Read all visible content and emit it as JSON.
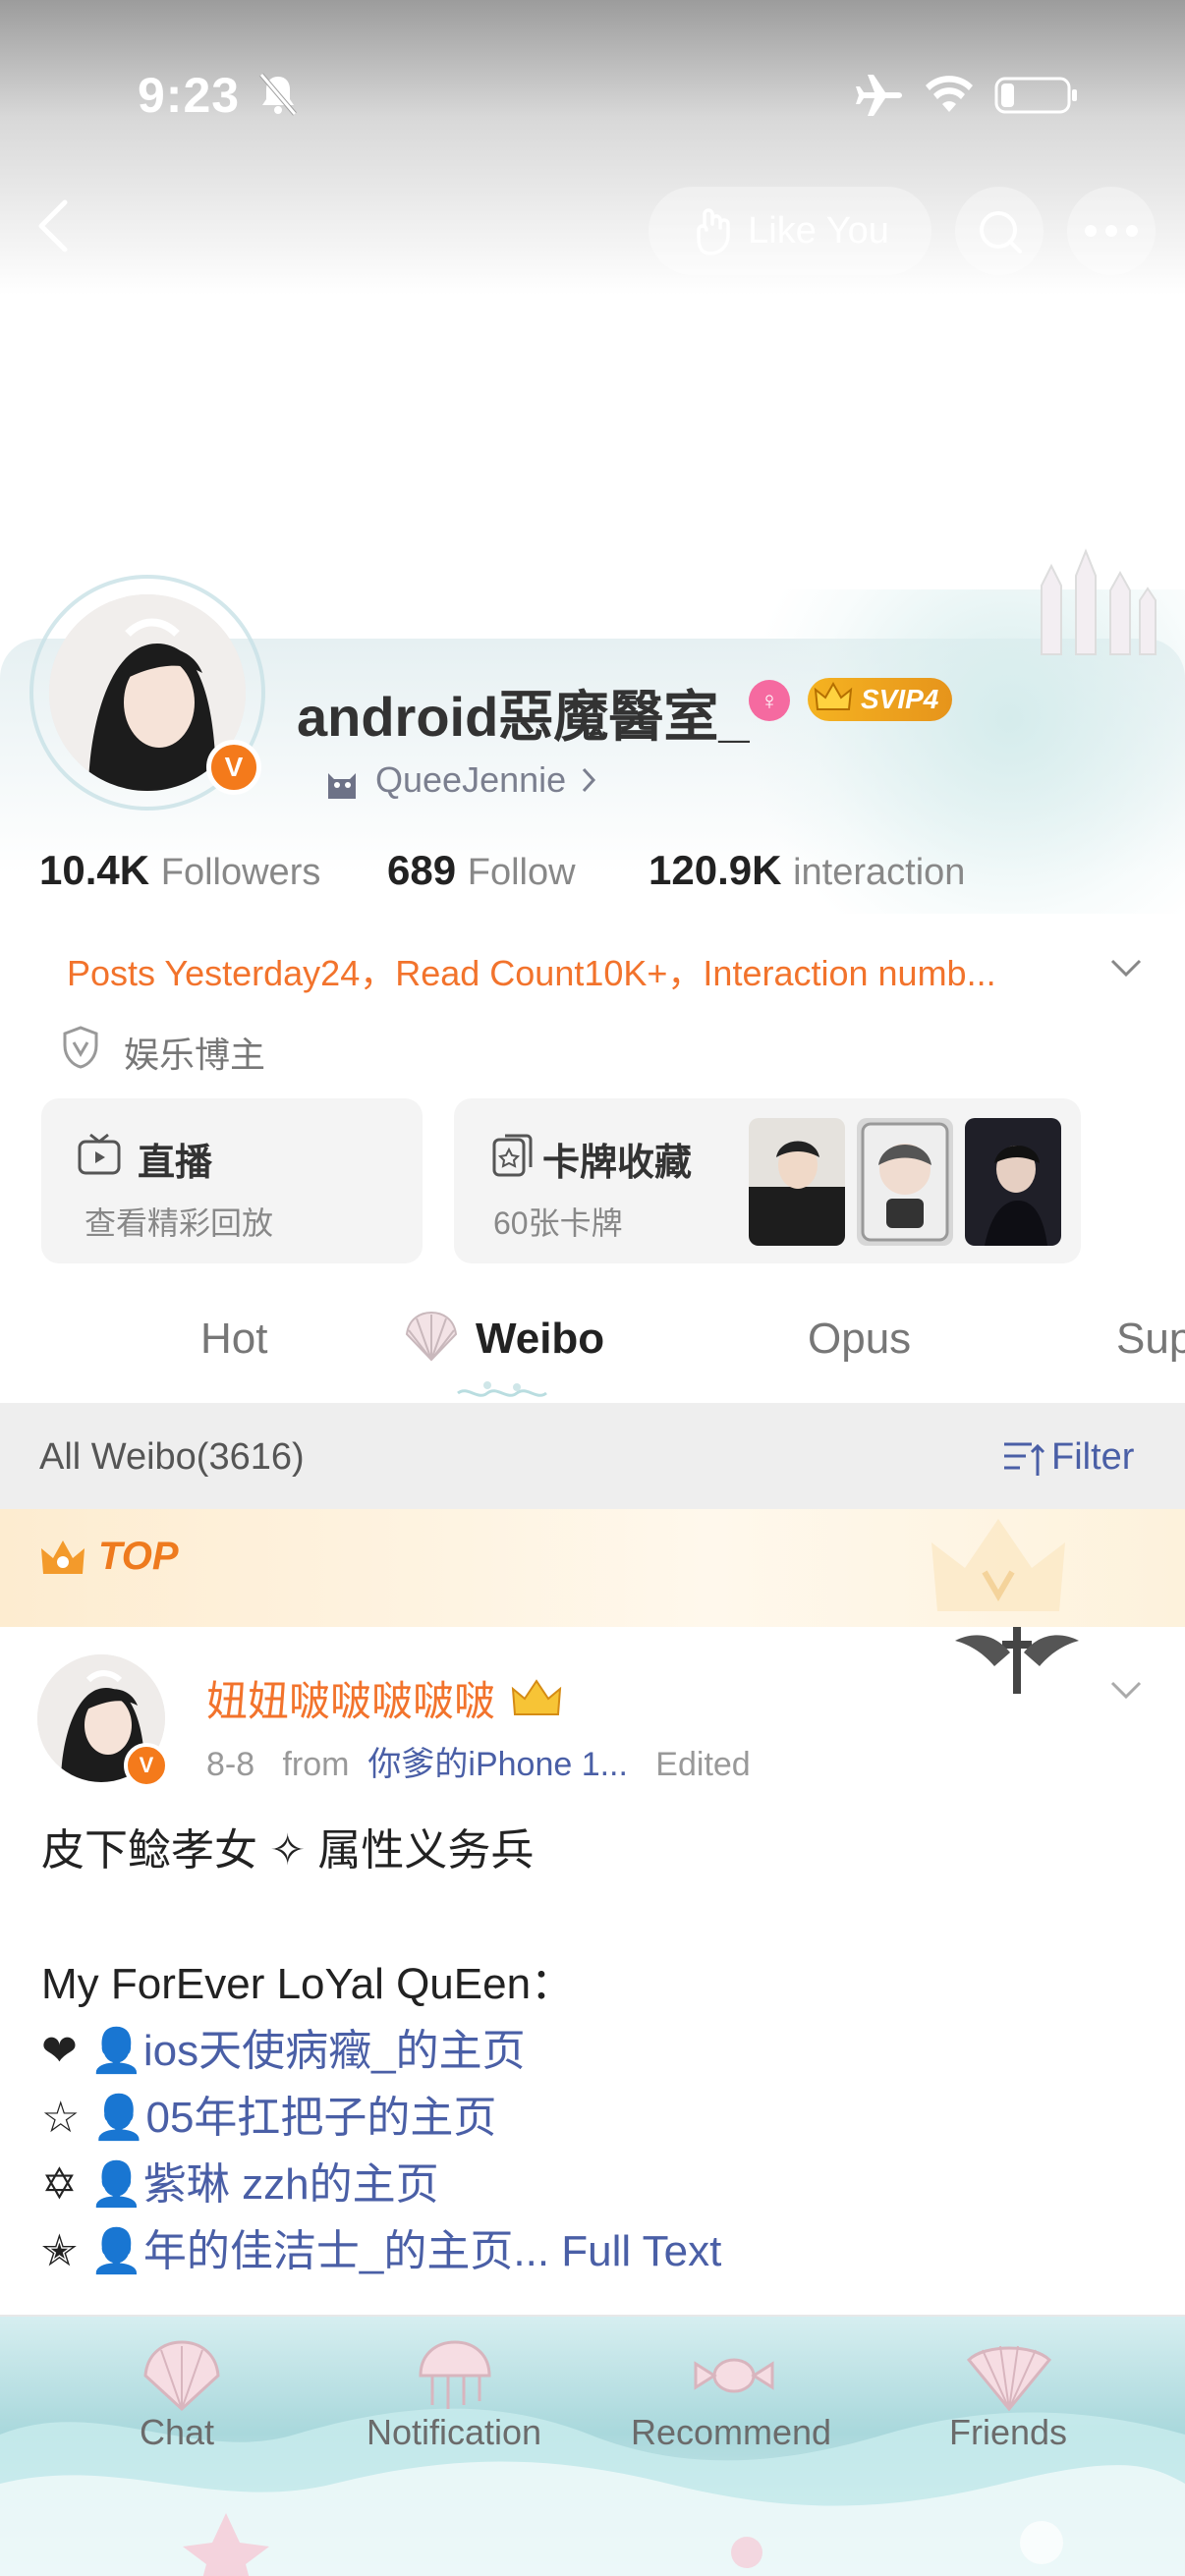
{
  "status_bar": {
    "time": "9:23"
  },
  "header": {
    "like_label": "Like You"
  },
  "profile": {
    "username": "android惡魔醫室_",
    "svip": "SVIP4",
    "sub_link": "QueeJennie",
    "stats": {
      "followers_value": "10.4K",
      "followers_label": "Followers",
      "follow_value": "689",
      "follow_label": "Follow",
      "interaction_value": "120.9K",
      "interaction_label": "interaction"
    },
    "summary": "Posts Yesterday24，Read Count10K+，Interaction numb...",
    "category": "娱乐博主",
    "live_card": {
      "title": "直播",
      "subtitle": "查看精彩回放"
    },
    "cards_card": {
      "title": "卡牌收藏",
      "subtitle": "60张卡牌"
    }
  },
  "tabs": [
    {
      "label": "Hot"
    },
    {
      "label": "Weibo"
    },
    {
      "label": "Opus"
    },
    {
      "label": "Sup"
    }
  ],
  "filter_bar": {
    "all_weibo": "All Weibo(3616)",
    "filter": "Filter"
  },
  "top_label": "TOP",
  "post": {
    "author": "妞妞啵啵啵啵啵",
    "date": "8-8",
    "from": "from",
    "source": "你爹的iPhone 1...",
    "edited": "Edited",
    "line1": "皮下鲶孝女 ✧ 属性义务兵",
    "line2": "My ForEver LoYal QuEen：",
    "mentions": [
      {
        "bullet": "❤",
        "text": "ios天使病癥_的主页"
      },
      {
        "bullet": "☆",
        "text": "05年扛把子的主页"
      },
      {
        "bullet": "✡",
        "text": "紫琳 zzh的主页"
      },
      {
        "bullet": "✭",
        "text": "年的佳洁士_的主页..."
      }
    ],
    "full_text": "Full Text"
  },
  "bottom_nav": [
    {
      "label": "Chat"
    },
    {
      "label": "Notification"
    },
    {
      "label": "Recommend"
    },
    {
      "label": "Friends"
    }
  ]
}
